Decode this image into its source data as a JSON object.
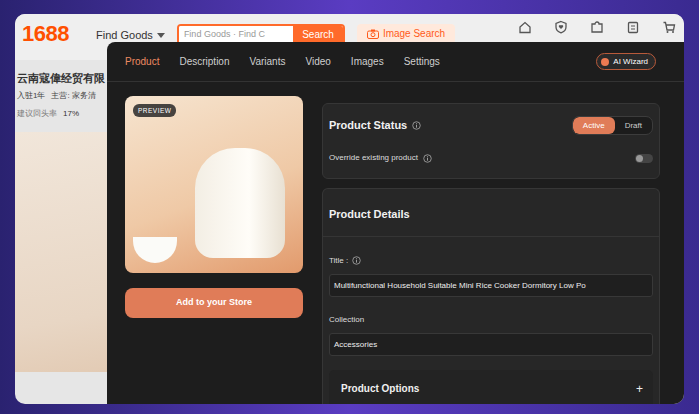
{
  "page": {
    "logo": "1688",
    "category_menu": "Find Goods",
    "search": {
      "placeholder": "Find Goods · Find C",
      "button": "Search"
    },
    "image_search": "Image Search",
    "shop": {
      "name": "云南寇偉经贸有限",
      "tenure": "入驻1年",
      "main_business": "主营: 家务清",
      "stat_label": "建议回头率",
      "stat_value": "17%"
    }
  },
  "modal": {
    "tabs": [
      {
        "label": "Product",
        "selected": true
      },
      {
        "label": "Description",
        "selected": false
      },
      {
        "label": "Variants",
        "selected": false
      },
      {
        "label": "Video",
        "selected": false
      },
      {
        "label": "Images",
        "selected": false
      },
      {
        "label": "Settings",
        "selected": false
      }
    ],
    "ai_button": "AI Wizard",
    "preview_badge": "PREVIEW",
    "add_button": "Add to your Store",
    "status": {
      "title": "Product Status",
      "options": [
        {
          "label": "Active",
          "selected": true
        },
        {
          "label": "Draft",
          "selected": false
        }
      ],
      "override": {
        "label": "Override existing product",
        "on": false
      }
    },
    "details": {
      "title": "Product Details",
      "fields": [
        {
          "label": "Title :",
          "info": true,
          "value": "Multifunctional Household Suitable Mini Rice Cooker Dormitory Low Po"
        },
        {
          "label": "Collection",
          "info": false,
          "value": "Accessories"
        }
      ],
      "options": {
        "title": "Product Options",
        "add": "+"
      }
    }
  }
}
